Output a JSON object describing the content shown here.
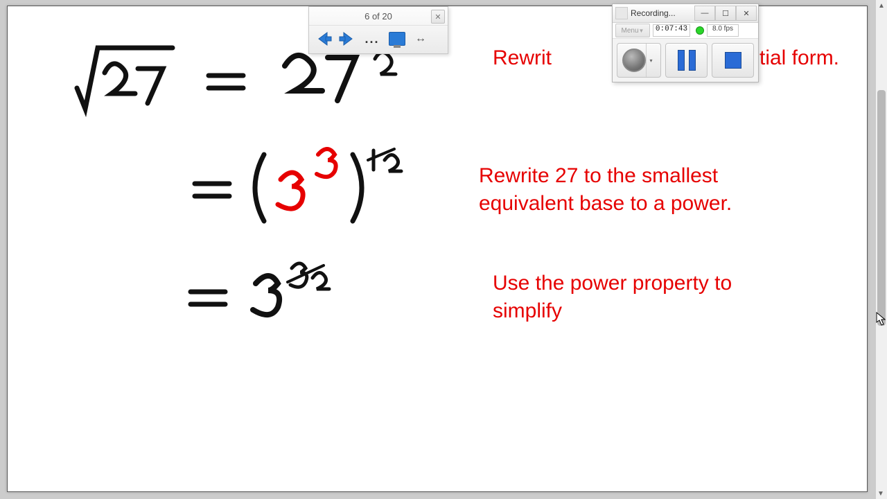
{
  "nav": {
    "page_label": "6 of 20"
  },
  "recorder": {
    "title": "Recording...",
    "menu_label": "Menu",
    "timecode": "0:07:43",
    "fps": "8.0 fps"
  },
  "annotations": {
    "line1_a": "Rewrit",
    "line1_b": "tial form.",
    "line2_a": "Rewrite 27 to the smallest",
    "line2_b": "equivalent base to a power.",
    "line3_a": "Use the power property to",
    "line3_b": "simplify"
  },
  "math": {
    "step1_left": "√27",
    "step1_right": "27",
    "step1_exp": "½",
    "step2_tokens": "= ( 3 ^ 3 ) ^ ½",
    "step3_tokens": "= 3 ^ 3/2"
  }
}
